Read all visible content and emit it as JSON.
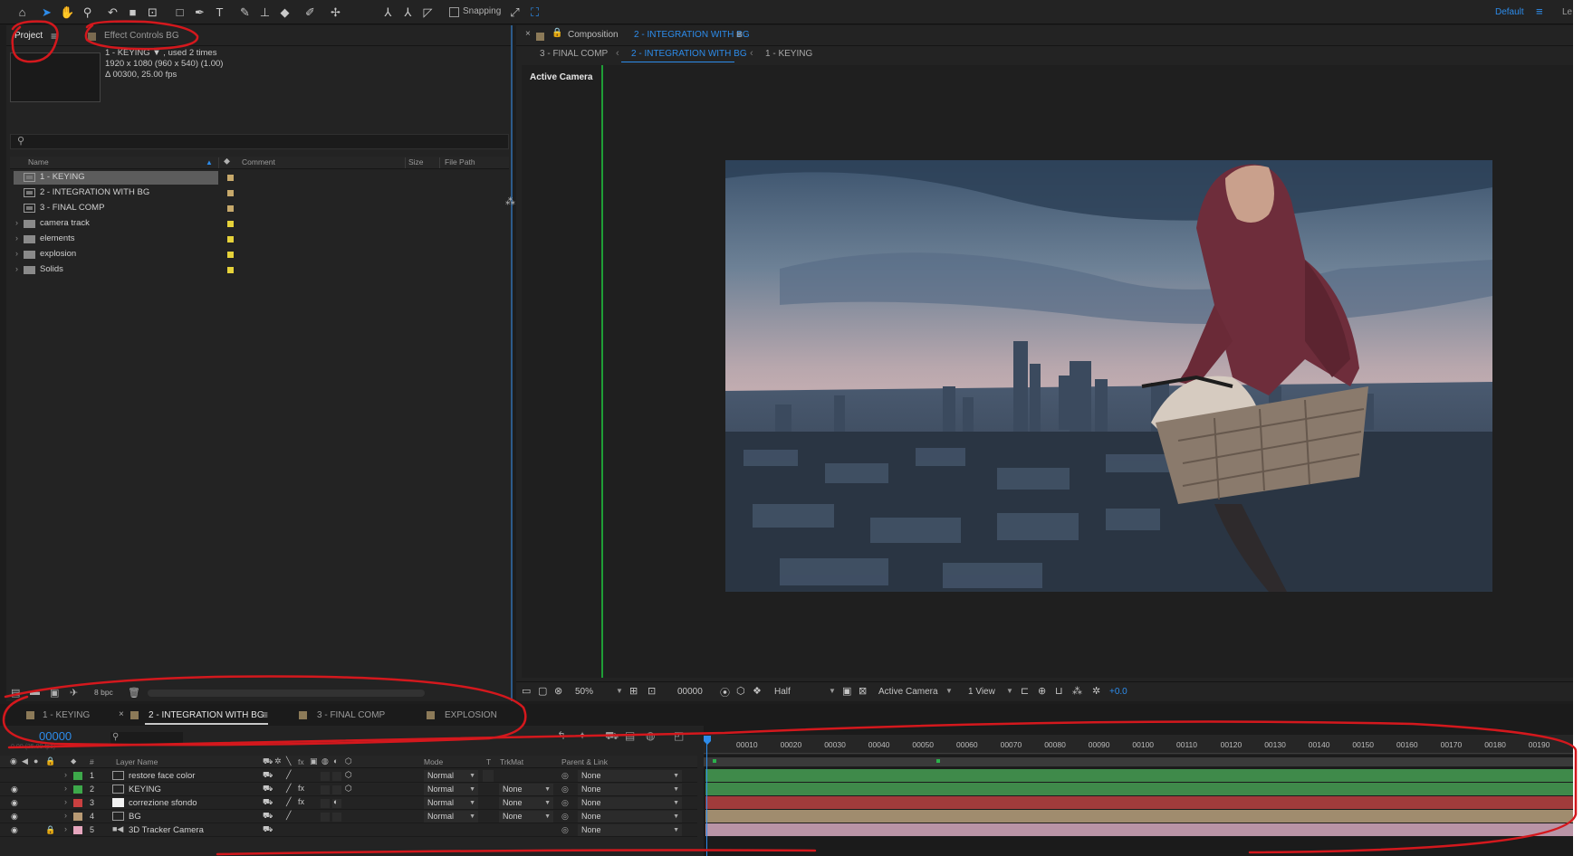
{
  "toolbar": {
    "snapping_label": "Snapping",
    "workspace": "Default",
    "workspace_more": "Le"
  },
  "project": {
    "tab_label": "Project",
    "effect_controls_label": "Effect Controls BG",
    "selected_item": "1 - KEYING ▼ , used 2 times",
    "resolution": "1920 x 1080  (960 x 540) (1.00)",
    "duration": "Δ 00300, 25.00 fps",
    "search_placeholder": "",
    "columns": [
      "Name",
      "Comment",
      "Size",
      "File Path"
    ],
    "items": [
      {
        "name": "1 - KEYING",
        "type": "comp",
        "label_color": "#c7a96b",
        "selected": true
      },
      {
        "name": "2 - INTEGRATION WITH BG",
        "type": "comp",
        "label_color": "#c7a96b",
        "selected": false
      },
      {
        "name": "3 - FINAL COMP",
        "type": "comp",
        "label_color": "#c7a96b",
        "selected": false
      },
      {
        "name": "camera track",
        "type": "folder",
        "label_color": "#e6d23a",
        "selected": false
      },
      {
        "name": "elements",
        "type": "folder",
        "label_color": "#e6d23a",
        "selected": false
      },
      {
        "name": "explosion",
        "type": "folder",
        "label_color": "#e6d23a",
        "selected": false
      },
      {
        "name": "Solids",
        "type": "folder",
        "label_color": "#e6d23a",
        "selected": false
      }
    ],
    "bit_depth": "8 bpc"
  },
  "composition": {
    "title_prefix": "Composition",
    "title_name": "2 - INTEGRATION WITH BG",
    "breadcrumbs": [
      "3 - FINAL COMP",
      "2 - INTEGRATION WITH BG",
      "1 - KEYING"
    ],
    "active_camera_label": "Active Camera",
    "footer": {
      "zoom": "50%",
      "timecode": "00000",
      "resolution": "Half",
      "camera": "Active Camera",
      "views": "1 View",
      "exposure": "+0.0"
    }
  },
  "timeline": {
    "tabs": [
      "1 - KEYING",
      "2 - INTEGRATION WITH BG",
      "3 - FINAL COMP",
      "EXPLOSION"
    ],
    "active_tab": "2 - INTEGRATION WITH BG",
    "current_time": "00000",
    "fps_note": "0.00 (25.00 fps)",
    "columns": {
      "layer_name": "Layer Name",
      "mode": "Mode",
      "t": "T",
      "trkmat": "TrkMat",
      "parent": "Parent & Link",
      "hash": "#"
    },
    "ruler_ticks": [
      "00010",
      "00020",
      "00030",
      "00040",
      "00050",
      "00060",
      "00070",
      "00080",
      "00090",
      "00100",
      "00110",
      "00120",
      "00130",
      "00140",
      "00150",
      "00160",
      "00170",
      "00180",
      "00190"
    ],
    "layers": [
      {
        "num": "1",
        "name": "restore face color",
        "label_color": "#3da84a",
        "mode": "Normal",
        "trkmat": "",
        "parent": "None",
        "bar_color": "#3f8a4a"
      },
      {
        "num": "2",
        "name": "KEYING",
        "label_color": "#3da84a",
        "mode": "Normal",
        "trkmat": "None",
        "parent": "None",
        "bar_color": "#3f8a4a"
      },
      {
        "num": "3",
        "name": "correzione sfondo",
        "label_color": "#c94040",
        "mode": "Normal",
        "trkmat": "None",
        "parent": "None",
        "bar_color": "#a13b3b"
      },
      {
        "num": "4",
        "name": "BG",
        "label_color": "#b89a74",
        "mode": "Normal",
        "trkmat": "None",
        "parent": "None",
        "bar_color": "#a08c6e"
      },
      {
        "num": "5",
        "name": "3D Tracker Camera",
        "label_color": "#e6a6be",
        "mode": "",
        "trkmat": "",
        "parent": "None",
        "bar_color": "#b994a6"
      }
    ]
  }
}
